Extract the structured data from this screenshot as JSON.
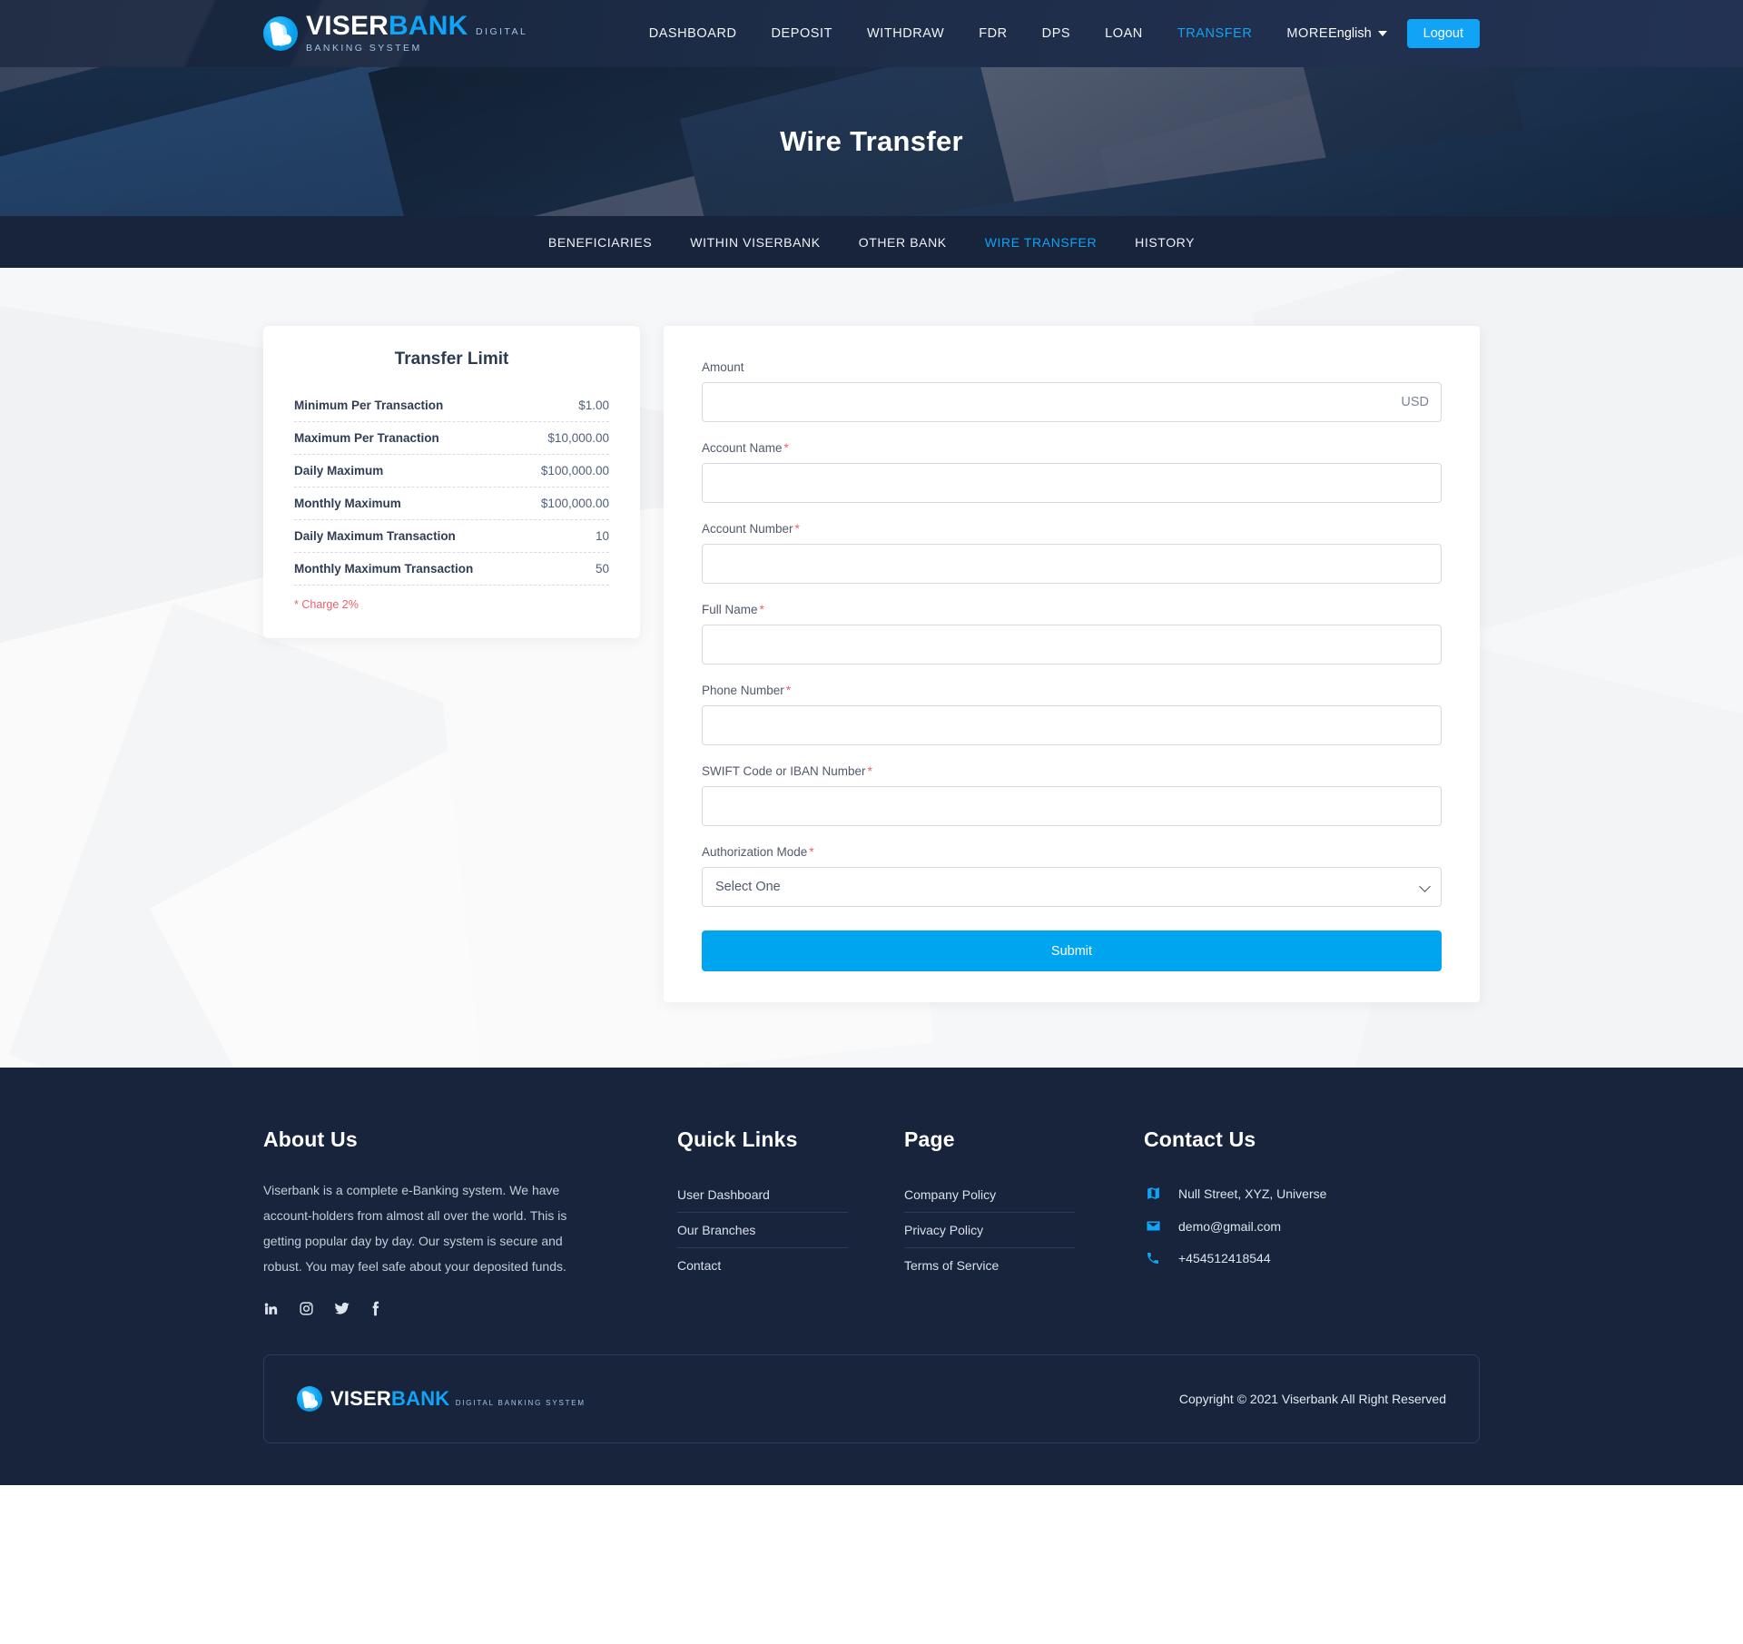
{
  "brand": {
    "name_first": "VISER",
    "name_second": "BANK",
    "tagline": "DIGITAL BANKING SYSTEM"
  },
  "navbar": {
    "menu": [
      {
        "label": "DASHBOARD",
        "active": false
      },
      {
        "label": "DEPOSIT",
        "active": false
      },
      {
        "label": "WITHDRAW",
        "active": false
      },
      {
        "label": "FDR",
        "active": false
      },
      {
        "label": "DPS",
        "active": false
      },
      {
        "label": "LOAN",
        "active": false
      },
      {
        "label": "TRANSFER",
        "active": true
      },
      {
        "label": "MORE",
        "active": false
      }
    ],
    "language": "English",
    "logout_label": "Logout",
    "accent_color": "#11a3f5"
  },
  "hero": {
    "title": "Wire Transfer"
  },
  "subnav": {
    "tabs": [
      {
        "label": "BENEFICIARIES",
        "active": false
      },
      {
        "label": "WITHIN VISERBANK",
        "active": false
      },
      {
        "label": "OTHER BANK",
        "active": false
      },
      {
        "label": "WIRE TRANSFER",
        "active": true
      },
      {
        "label": "HISTORY",
        "active": false
      }
    ]
  },
  "transfer_limit": {
    "title": "Transfer Limit",
    "rows": [
      {
        "key": "Minimum Per Transaction",
        "value": "$1.00"
      },
      {
        "key": "Maximum Per Tranaction",
        "value": "$10,000.00"
      },
      {
        "key": "Daily Maximum",
        "value": "$100,000.00"
      },
      {
        "key": "Monthly Maximum",
        "value": "$100,000.00"
      },
      {
        "key": "Daily Maximum Transaction",
        "value": "10"
      },
      {
        "key": "Monthly Maximum Transaction",
        "value": "50"
      }
    ],
    "note": "* Charge 2%",
    "note_color": "#e8616d"
  },
  "form": {
    "amount": {
      "label": "Amount",
      "required": false,
      "value": "",
      "placeholder": "",
      "currency_suffix": "USD"
    },
    "account_name": {
      "label": "Account Name",
      "required": true,
      "value": "",
      "placeholder": ""
    },
    "account_number": {
      "label": "Account Number",
      "required": true,
      "value": "",
      "placeholder": ""
    },
    "full_name": {
      "label": "Full Name",
      "required": true,
      "value": "",
      "placeholder": ""
    },
    "phone_number": {
      "label": "Phone Number",
      "required": true,
      "value": "",
      "placeholder": ""
    },
    "swift": {
      "label": "SWIFT Code or IBAN Number",
      "required": true,
      "value": "",
      "placeholder": ""
    },
    "authorization_mode": {
      "label": "Authorization Mode",
      "required": true,
      "selected": "Select One",
      "options": [
        "Select One"
      ]
    },
    "submit_label": "Submit",
    "required_marker": "*",
    "submit_color": "#00a5f0"
  },
  "footer": {
    "about": {
      "heading": "About Us",
      "text": "Viserbank is a complete e-Banking system. We have account-holders from almost all over the world. This is getting popular day by day. Our system is secure and robust. You may feel safe about your deposited funds.",
      "socials": [
        "linkedin-icon",
        "instagram-icon",
        "twitter-icon",
        "facebook-icon"
      ]
    },
    "quick_links": {
      "heading": "Quick Links",
      "items": [
        "User Dashboard",
        "Our Branches",
        "Contact"
      ]
    },
    "page": {
      "heading": "Page",
      "items": [
        "Company Policy",
        "Privacy Policy",
        "Terms of Service"
      ]
    },
    "contact": {
      "heading": "Contact Us",
      "items": [
        {
          "icon": "map-marker-icon",
          "text": "Null Street, XYZ, Universe"
        },
        {
          "icon": "envelope-icon",
          "text": "demo@gmail.com"
        },
        {
          "icon": "phone-icon",
          "text": "+454512418544"
        }
      ]
    },
    "copyright": "Copyright © 2021 Viserbank All Right Reserved"
  }
}
